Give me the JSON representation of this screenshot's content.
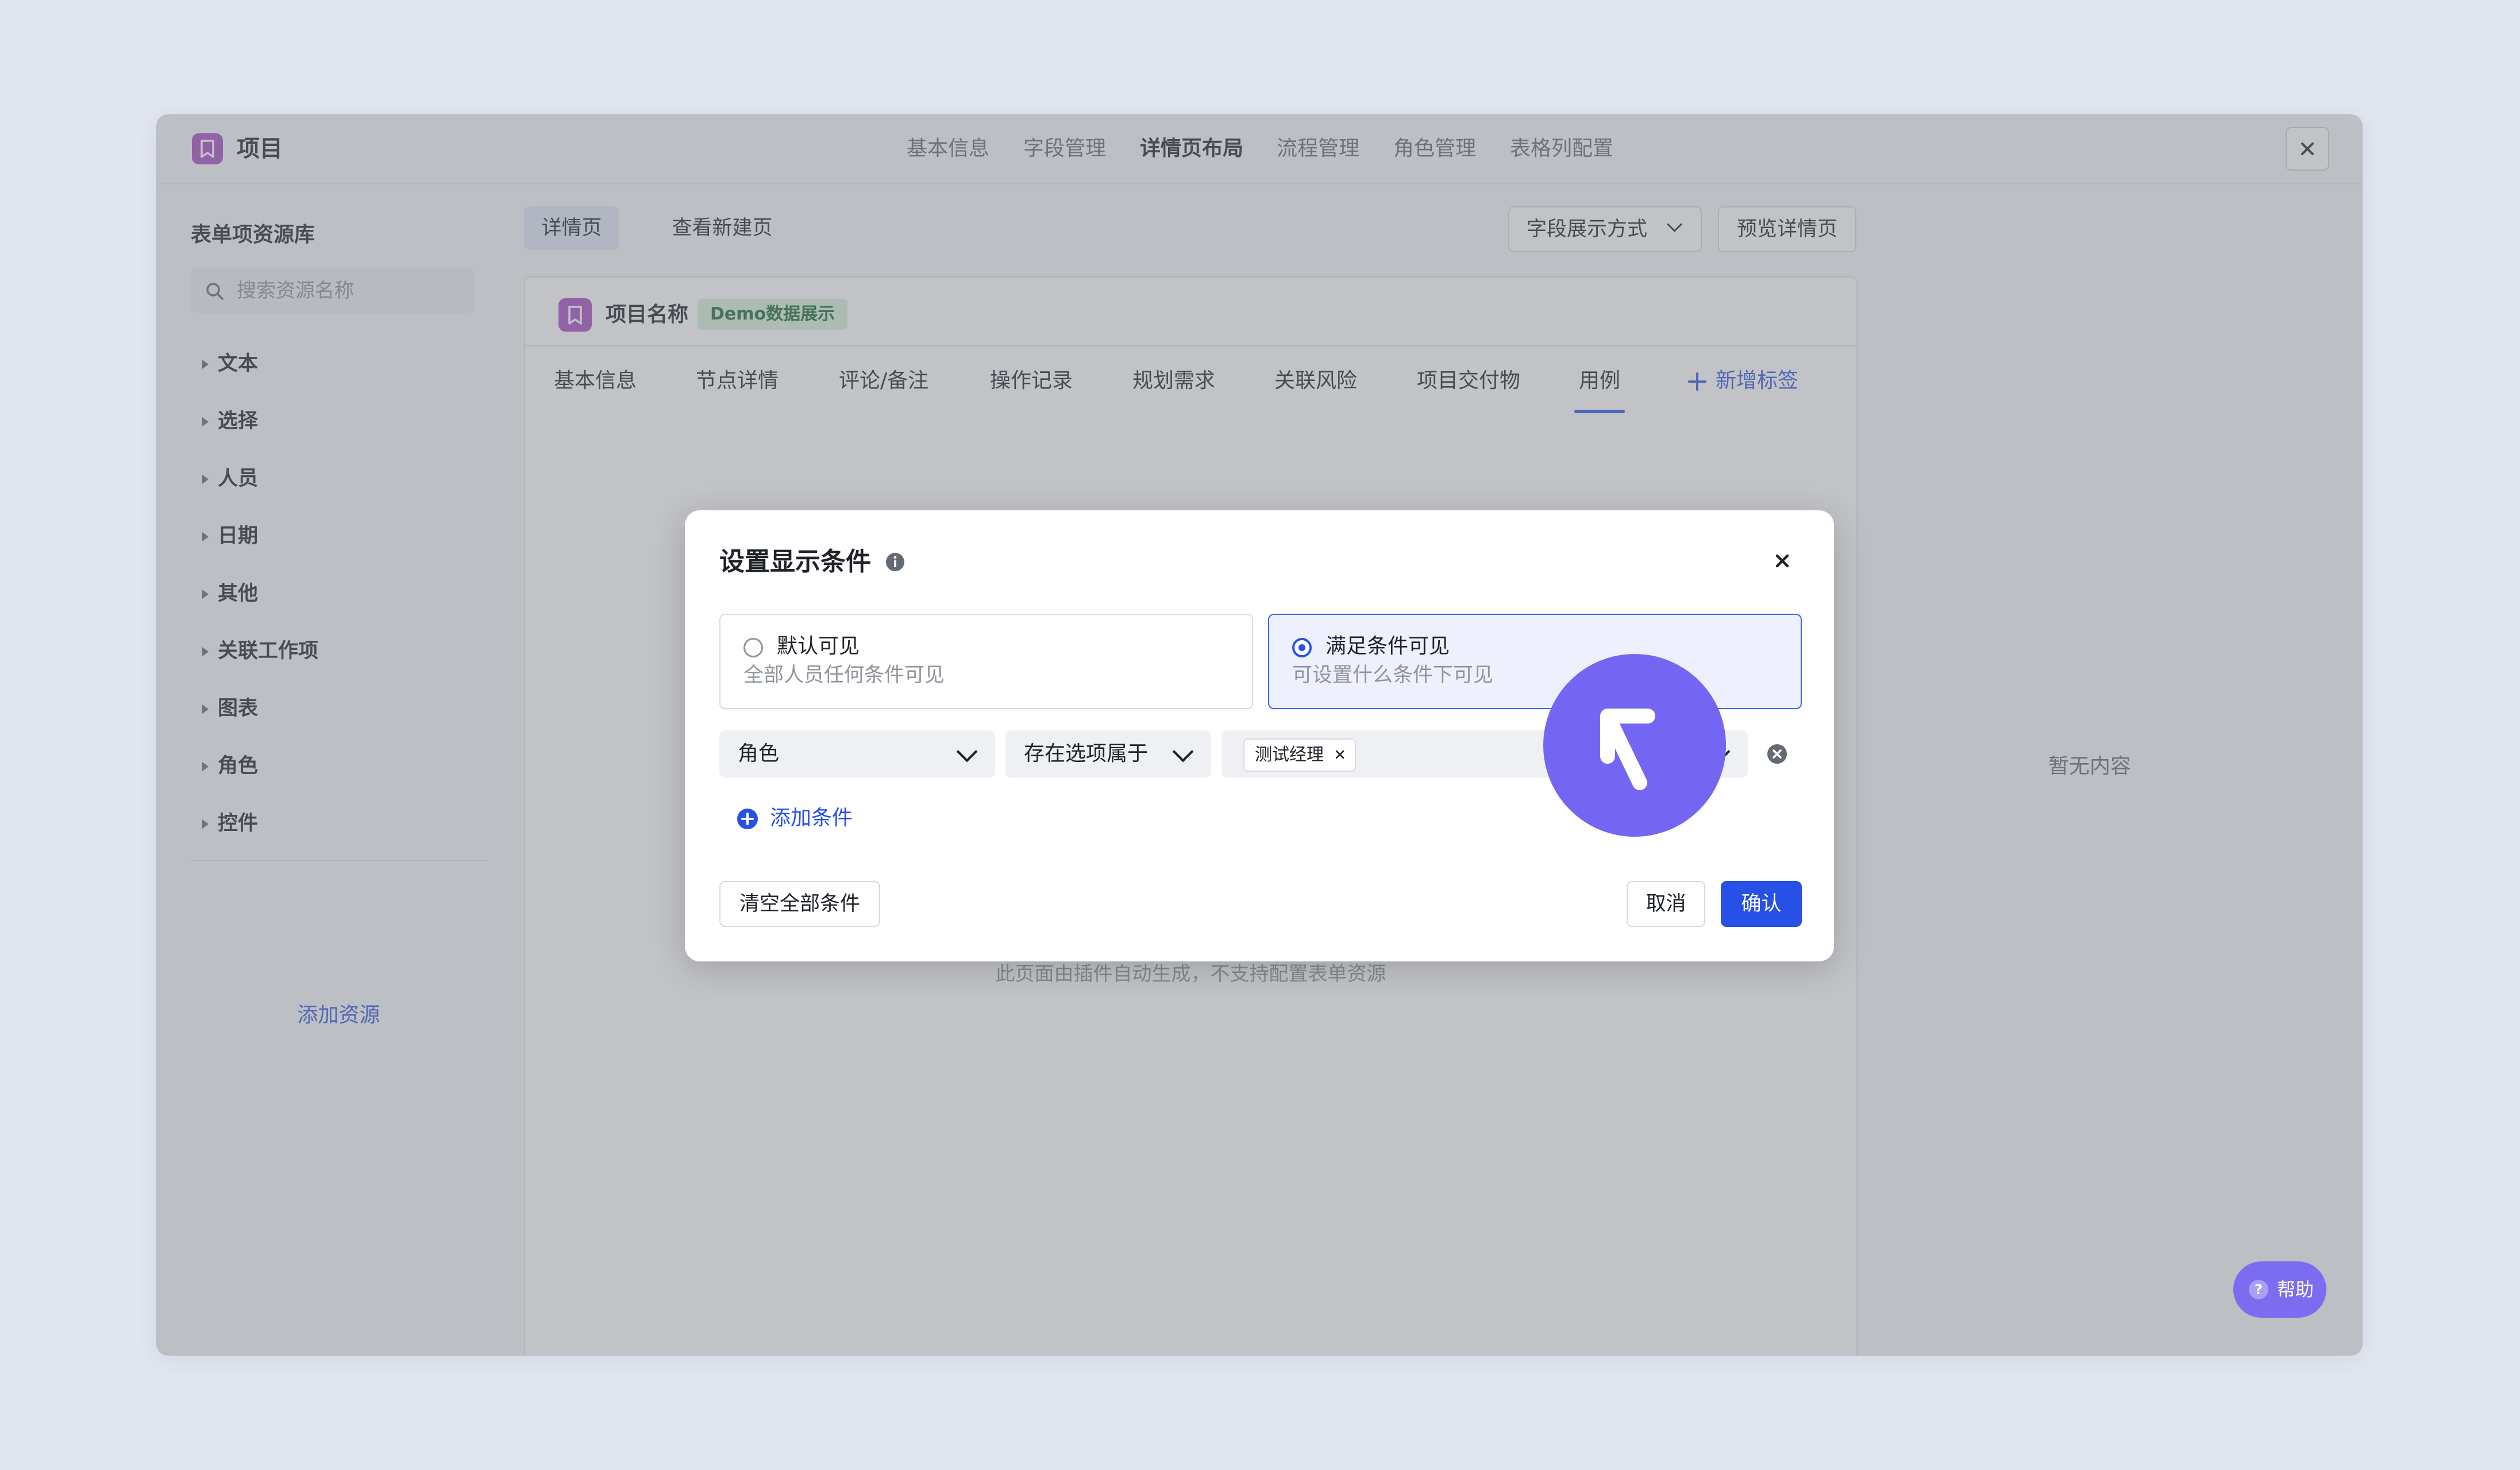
{
  "app": {
    "title": "项目",
    "nav_tabs": [
      "基本信息",
      "字段管理",
      "详情页布局",
      "流程管理",
      "角色管理",
      "表格列配置"
    ],
    "active_nav": "详情页布局"
  },
  "sidebar": {
    "title": "表单项资源库",
    "search_placeholder": "搜索资源名称",
    "items": [
      "文本",
      "选择",
      "人员",
      "日期",
      "其他",
      "关联工作项",
      "图表",
      "角色",
      "控件"
    ],
    "add_resource": "添加资源"
  },
  "toolbar": {
    "tabs": [
      "详情页",
      "查看新建页"
    ],
    "field_display_mode": "字段展示方式",
    "preview": "预览详情页"
  },
  "detail": {
    "item_name": "项目名称",
    "demo_badge": "Demo数据展示",
    "tabs": [
      "基本信息",
      "节点详情",
      "评论/备注",
      "操作记录",
      "规划需求",
      "关联风险",
      "项目交付物",
      "用例"
    ],
    "active_tab": "用例",
    "add_tab": "新增标签",
    "empty_hint": "此页面由插件自动生成，不支持配置表单资源"
  },
  "right_panel": {
    "empty": "暂无内容"
  },
  "modal": {
    "title": "设置显示条件",
    "options": [
      {
        "title": "默认可见",
        "desc": "全部人员任何条件可见",
        "selected": false
      },
      {
        "title": "满足条件可见",
        "desc": "可设置什么条件下可见",
        "selected": true
      }
    ],
    "condition": {
      "field": "角色",
      "operator": "存在选项属于",
      "values": [
        "测试经理"
      ]
    },
    "add_condition": "添加条件",
    "clear_all": "清空全部条件",
    "cancel": "取消",
    "confirm": "确认"
  },
  "help": {
    "label": "帮助"
  },
  "colors": {
    "primary": "#2750e6",
    "link": "#3556d8",
    "demo_badge_bg": "#d8f0dd",
    "demo_badge_text": "#1f6b33",
    "cursor_highlight": "#7466f3"
  }
}
